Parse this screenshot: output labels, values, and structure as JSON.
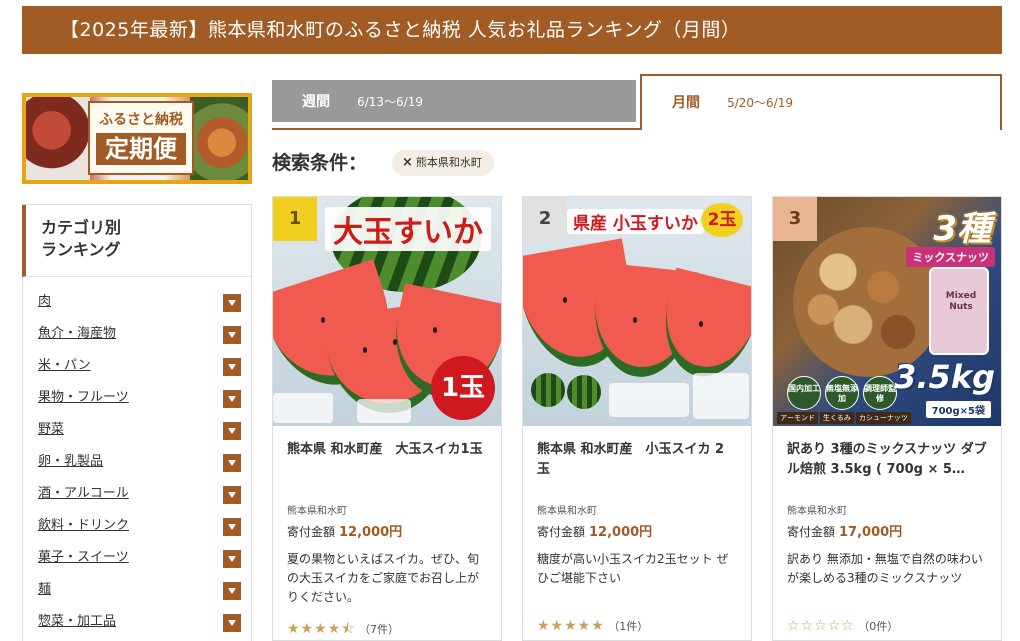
{
  "page_title": "【2025年最新】熊本県和水町のふるさと納税 人気お礼品ランキング（月間）",
  "banner": {
    "line1": "ふるさと納税",
    "line2": "定期便"
  },
  "sidebar": {
    "heading_line1": "カテゴリ別",
    "heading_line2": "ランキング",
    "categories": [
      {
        "label": "肉"
      },
      {
        "label": "魚介・海産物"
      },
      {
        "label": "米・パン"
      },
      {
        "label": "果物・フルーツ"
      },
      {
        "label": "野菜"
      },
      {
        "label": "卵・乳製品"
      },
      {
        "label": "酒・アルコール"
      },
      {
        "label": "飲料・ドリンク"
      },
      {
        "label": "菓子・スイーツ"
      },
      {
        "label": "麺"
      },
      {
        "label": "惣菜・加工品"
      }
    ]
  },
  "tabs": {
    "weekly": {
      "label": "週間",
      "range": "6/13〜6/19"
    },
    "monthly": {
      "label": "月間",
      "range": "5/20〜6/19"
    }
  },
  "search": {
    "label": "検索条件：",
    "chip_close": "×",
    "chip_label": "熊本県和水町"
  },
  "products": [
    {
      "rank": "1",
      "image_title": "大玉すいか",
      "image_badge": "1玉",
      "title": "熊本県 和水町産　大玉スイカ1玉",
      "municipality": "熊本県和水町",
      "price_label": "寄付金額",
      "price": "12,000円",
      "description": "夏の果物といえばスイカ。ぜひ、旬の大玉スイカをご家庭でお召し上がりください。",
      "rating_value": 4.5,
      "stars": "★★★★⯪",
      "review_count": "（7件）"
    },
    {
      "rank": "2",
      "image_title": "県産 小玉すいか",
      "image_badge": "2玉",
      "title": "熊本県 和水町産　小玉スイカ 2玉",
      "municipality": "熊本県和水町",
      "price_label": "寄付金額",
      "price": "12,000円",
      "description": "糖度が高い小玉スイカ2玉セット ぜひご堪能下さい",
      "rating_value": 5,
      "stars": "★★★★★",
      "review_count": "（1件）"
    },
    {
      "rank": "3",
      "image_title": "3種",
      "image_subtitle": "ミックスナッツ",
      "bag_text": "Mixed Nuts",
      "image_weight": "3.5kg",
      "image_sub": "700g×5袋",
      "chips": [
        "国内加工",
        "無塩無添加",
        "調理師監修"
      ],
      "tags": [
        "アーモンド",
        "生くるみ",
        "カシューナッツ"
      ],
      "title": "訳あり 3種のミックスナッツ ダブル焙煎 3.5kg ( 700g × 5…",
      "municipality": "熊本県和水町",
      "price_label": "寄付金額",
      "price": "17,000円",
      "description": "訳あり 無添加・無塩で自然の味わいが楽しめる3種のミックスナッツ",
      "rating_value": 0,
      "stars": "☆☆☆☆☆",
      "review_count": "（0件）"
    }
  ],
  "colors": {
    "brand": "#a15c25",
    "tab_inactive": "#999999",
    "star": "#c9a15a",
    "rank1": "#f2cf1e",
    "rank2": "#e1e1e1",
    "rank3": "#e7b592"
  }
}
